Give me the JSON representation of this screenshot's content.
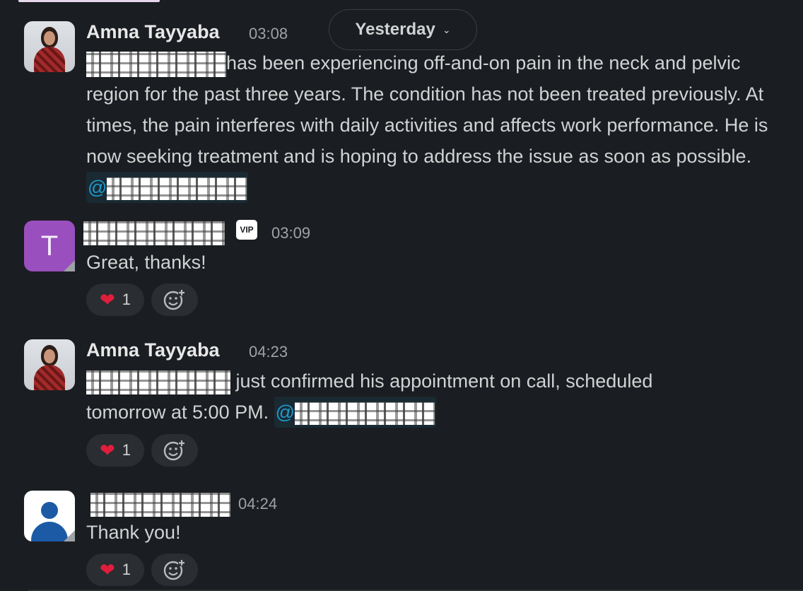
{
  "date_divider": {
    "label": "Yesterday",
    "chevron": "chevron-down-icon"
  },
  "messages": [
    {
      "author": "Amna Tayyaba",
      "time": "03:08",
      "avatar": "photo",
      "text": "has been experiencing off-and-on pain in the neck and pelvic region for the past three years. The condition has not been treated previously. At times, the pain interferes with daily activities and affects work performance. He is now seeking treatment and is hoping to address the issue as soon as possible.",
      "mention_prefix": "@"
    },
    {
      "author": "",
      "badge": "VIP",
      "time": "03:09",
      "avatar_letter": "T",
      "text": "Great, thanks!",
      "reaction": {
        "emoji": "heart",
        "count": "1"
      }
    },
    {
      "author": "Amna Tayyaba",
      "time": "04:23",
      "avatar": "photo",
      "text_line1": "just confirmed his appointment on call, scheduled",
      "text_line2": "tomorrow at 5:00 PM.",
      "mention_prefix": "@",
      "reaction": {
        "emoji": "heart",
        "count": "1"
      }
    },
    {
      "author": "",
      "time": "04:24",
      "avatar": "default-person",
      "text": "Thank you!",
      "reaction": {
        "emoji": "heart",
        "count": "1"
      }
    }
  ],
  "colors": {
    "background": "#1a1d21",
    "mention": "#1d9bd1",
    "heart": "#e01e3c",
    "avatar_t": "#9a4fbe"
  }
}
